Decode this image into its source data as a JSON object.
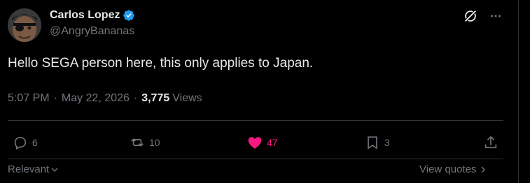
{
  "author": {
    "name": "Carlos Lopez",
    "handle": "@AngryBananas",
    "verified": true
  },
  "tweet": {
    "text": "Hello SEGA person here, this only applies to Japan.",
    "time": "5:07 PM",
    "date": "May 22, 2026",
    "views_count": "3,775",
    "views_label": "Views"
  },
  "actions": {
    "replies": "6",
    "reposts": "10",
    "likes": "47",
    "bookmarks": "3"
  },
  "footer": {
    "sort_label": "Relevant",
    "view_quotes_label": "View quotes"
  },
  "colors": {
    "background": "#000000",
    "text": "#e7e9ea",
    "muted": "#71767b",
    "verified": "#1d9bf0",
    "like": "#f91880"
  },
  "icons": [
    "verified-badge-icon",
    "grok-icon",
    "more-icon",
    "reply-icon",
    "repost-icon",
    "like-icon",
    "bookmark-icon",
    "share-icon",
    "chevron-down-icon",
    "chevron-right-icon"
  ]
}
